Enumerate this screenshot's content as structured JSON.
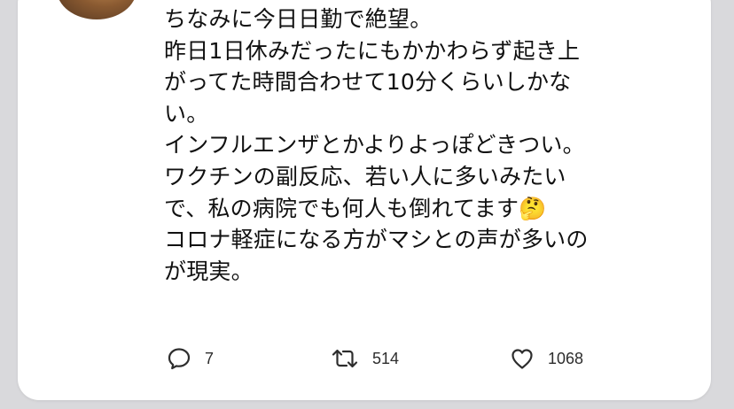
{
  "tweet": {
    "lines": [
      "ちなみに今日日勤で絶望。",
      "昨日1日休みだったにもかかわらず起き上",
      "がってた時間合わせて10分くらいしかな",
      "い。",
      "インフルエンザとかよりよっぽどきつい。",
      "ワクチンの副反応、若い人に多いみたい",
      "で、私の病院でも何人も倒れてます🤔",
      "コロナ軽症になる方がマシとの声が多いの",
      "が現実。"
    ]
  },
  "actions": {
    "reply": {
      "icon": "reply-icon",
      "count": "7"
    },
    "retweet": {
      "icon": "retweet-icon",
      "count": "514"
    },
    "like": {
      "icon": "heart-icon",
      "count": "1068"
    }
  },
  "colors": {
    "background": "#d9d9dc",
    "card": "#ffffff",
    "text": "#111111",
    "icon": "#2d2d2d"
  }
}
